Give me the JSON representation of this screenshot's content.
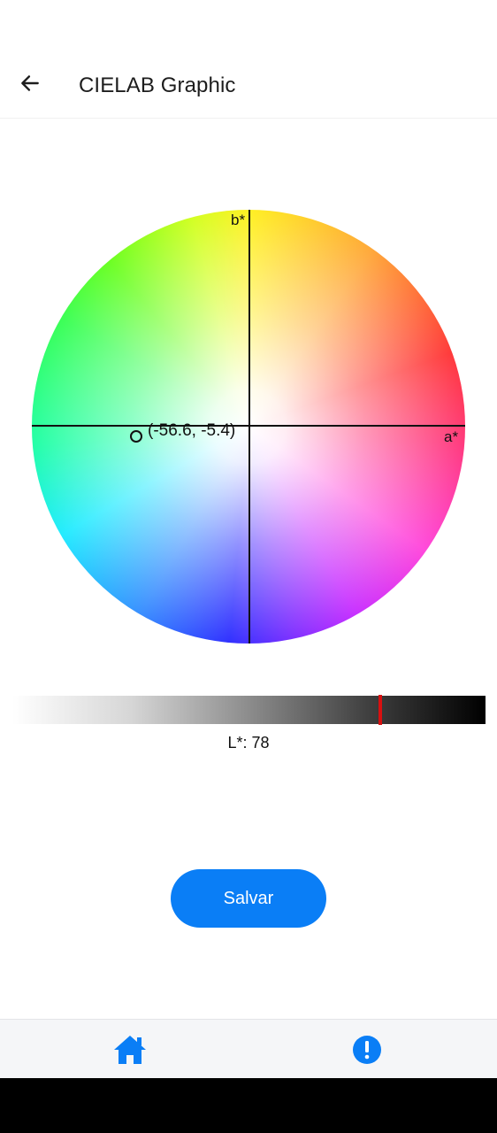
{
  "header": {
    "title": "CIELAB Graphic",
    "back_icon": "arrow-left-icon"
  },
  "chart": {
    "b_axis_label": "b*",
    "a_axis_label": "a*",
    "point_label": "(-56.6, -5.4)"
  },
  "lightness": {
    "label": "L*: 78",
    "marker_fraction": 0.78,
    "marker_color": "#d81010"
  },
  "actions": {
    "save_label": "Salvar",
    "save_color": "#0a7ef6"
  },
  "bottom_nav": {
    "items": [
      {
        "icon": "home-icon"
      },
      {
        "icon": "alert-circle-icon"
      }
    ],
    "accent": "#0a7ef6"
  }
}
